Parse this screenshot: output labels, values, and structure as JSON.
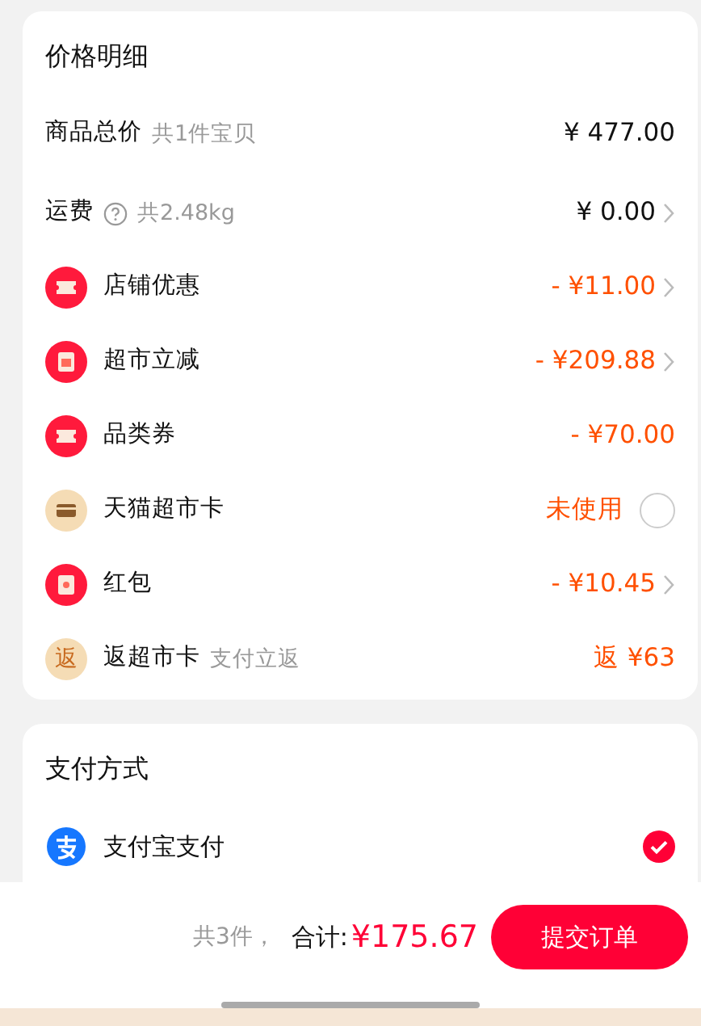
{
  "price_card": {
    "title": "价格明细",
    "rows": [
      {
        "kind": "plain",
        "label": "商品总价",
        "note": "共1件宝贝",
        "help": false,
        "value": "¥ 477.00",
        "discount": false,
        "chevron": false
      },
      {
        "kind": "plain",
        "label": "运费",
        "note": "共2.48kg",
        "help": true,
        "value": "¥ 0.00",
        "discount": false,
        "chevron": true
      },
      {
        "kind": "ticket",
        "label": "店铺优惠",
        "value": "- ¥11.00",
        "discount": true,
        "chevron": true
      },
      {
        "kind": "reduce",
        "label": "超市立减",
        "value": "- ¥209.88",
        "discount": true,
        "chevron": true
      },
      {
        "kind": "ticket",
        "label": "品类券",
        "value": "- ¥70.00",
        "discount": true,
        "chevron": false
      },
      {
        "kind": "card",
        "label": "天猫超市卡",
        "value": "未使用",
        "discount": true,
        "chevron": false,
        "radio": {
          "checked": false
        }
      },
      {
        "kind": "redpacket",
        "label": "红包",
        "value": "- ¥10.45",
        "discount": true,
        "chevron": true
      },
      {
        "kind": "return",
        "icon_text": "返",
        "label": "返超市卡",
        "note": "支付立返",
        "help": false,
        "value": "返 ¥63",
        "discount": true,
        "chevron": false
      }
    ]
  },
  "payment_card": {
    "title": "支付方式",
    "methods": [
      {
        "label": "支付宝支付",
        "selected": true
      }
    ]
  },
  "footer": {
    "count": "共3件，",
    "total_label": "合计:",
    "total": "¥175.67",
    "submit": "提交订单"
  }
}
